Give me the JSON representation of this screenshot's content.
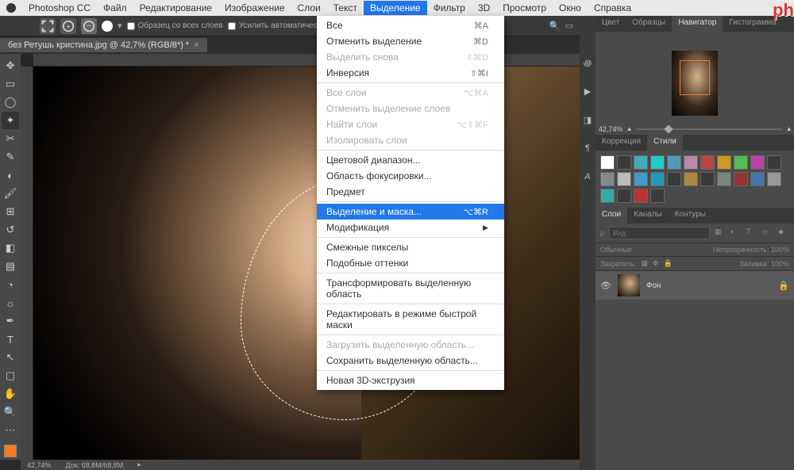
{
  "menubar": {
    "app": "Photoshop CC",
    "items": [
      "Файл",
      "Редактирование",
      "Изображение",
      "Слои",
      "Текст",
      "Выделение",
      "Фильтр",
      "3D",
      "Просмотр",
      "Окно",
      "Справка"
    ],
    "active_index": 5
  },
  "options_bar": {
    "sample_all": "Образец со всех слоев",
    "auto_enhance": "Усилить автоматически"
  },
  "document_tab": {
    "title": "без Ретушь кристина.jpg @ 42,7% (RGB/8*) *"
  },
  "dropdown": {
    "groups": [
      [
        {
          "label": "Все",
          "shortcut": "⌘A",
          "disabled": false
        },
        {
          "label": "Отменить выделение",
          "shortcut": "⌘D",
          "disabled": false
        },
        {
          "label": "Выделить снова",
          "shortcut": "⇧⌘D",
          "disabled": true
        },
        {
          "label": "Инверсия",
          "shortcut": "⇧⌘I",
          "disabled": false
        }
      ],
      [
        {
          "label": "Все слои",
          "shortcut": "⌥⌘A",
          "disabled": true
        },
        {
          "label": "Отменить выделение слоев",
          "shortcut": "",
          "disabled": true
        },
        {
          "label": "Найти слои",
          "shortcut": "⌥⇧⌘F",
          "disabled": true
        },
        {
          "label": "Изолировать слои",
          "shortcut": "",
          "disabled": true
        }
      ],
      [
        {
          "label": "Цветовой диапазон...",
          "shortcut": "",
          "disabled": false
        },
        {
          "label": "Область фокусировки...",
          "shortcut": "",
          "disabled": false
        },
        {
          "label": "Предмет",
          "shortcut": "",
          "disabled": false
        }
      ],
      [
        {
          "label": "Выделение и маска...",
          "shortcut": "⌥⌘R",
          "disabled": false,
          "highlighted": true
        },
        {
          "label": "Модификация",
          "shortcut": "",
          "disabled": false,
          "submenu": true
        }
      ],
      [
        {
          "label": "Смежные пикселы",
          "shortcut": "",
          "disabled": false
        },
        {
          "label": "Подобные оттенки",
          "shortcut": "",
          "disabled": false
        }
      ],
      [
        {
          "label": "Трансформировать выделенную область",
          "shortcut": "",
          "disabled": false
        }
      ],
      [
        {
          "label": "Редактировать в режиме быстрой маски",
          "shortcut": "",
          "disabled": false
        }
      ],
      [
        {
          "label": "Загрузить выделенную область...",
          "shortcut": "",
          "disabled": true
        },
        {
          "label": "Сохранить выделенную область...",
          "shortcut": "",
          "disabled": false
        }
      ],
      [
        {
          "label": "Новая 3D-экструзия",
          "shortcut": "",
          "disabled": false
        }
      ]
    ]
  },
  "navigator": {
    "tabs": [
      "Цвет",
      "Образцы",
      "Навигатор",
      "Гистограмма"
    ],
    "active_tab": 2,
    "zoom": "42,74%"
  },
  "styles": {
    "tabs": [
      "Коррекция",
      "Стили"
    ],
    "active_tab": 1,
    "swatches": [
      "#fff",
      "#3a3a3a",
      "#4ab",
      "#2cc",
      "#59b",
      "#b8a",
      "#b44",
      "#c92",
      "#5b5",
      "#b4a",
      "#3a3a3a",
      "#888",
      "#bbb",
      "#49c",
      "#29b",
      "#3a3a3a",
      "#a84",
      "#3a3a3a",
      "#787",
      "#933",
      "#47a",
      "#999",
      "#3aa",
      "#3a3a3a",
      "#b33",
      "#3a3a3a"
    ]
  },
  "layers": {
    "tabs": [
      "Слои",
      "Каналы",
      "Контуры"
    ],
    "active_tab": 0,
    "search_placeholder": "Вид",
    "blend_mode": "Обычные",
    "opacity_label": "Непрозрачность:",
    "opacity_value": "100%",
    "lock_label": "Закрепить:",
    "fill_label": "Заливка:",
    "fill_value": "100%",
    "layer_name": "Фон"
  },
  "status_bar": {
    "zoom": "42,74%",
    "doc_size": "Док: 68,8M/68,8M"
  },
  "watermark": "ph",
  "colors": {
    "highlight": "#2178e8",
    "accent": "#ff7a1a"
  }
}
